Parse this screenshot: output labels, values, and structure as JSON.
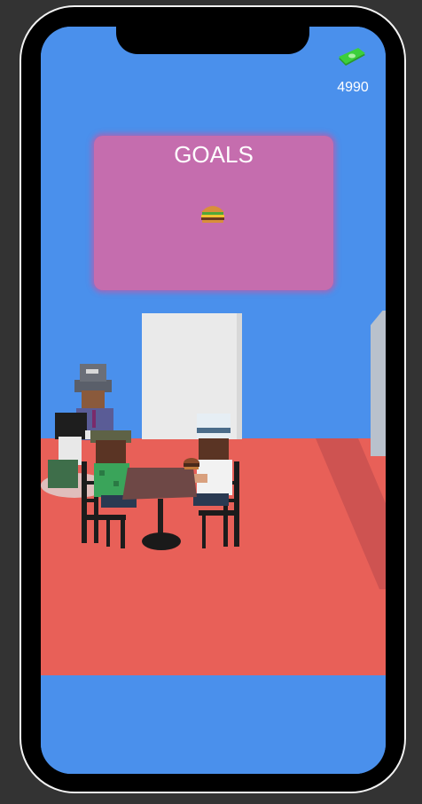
{
  "hud": {
    "currency_icon": "cash-stack-icon",
    "currency_value": "4990"
  },
  "goals": {
    "title": "GOALS",
    "items": [
      {
        "icon": "burger-icon"
      }
    ]
  },
  "colors": {
    "sky": "#4a90ec",
    "floor": "#e86058",
    "goals_panel": "#c56dae",
    "cash_green": "#3ccf3c"
  }
}
